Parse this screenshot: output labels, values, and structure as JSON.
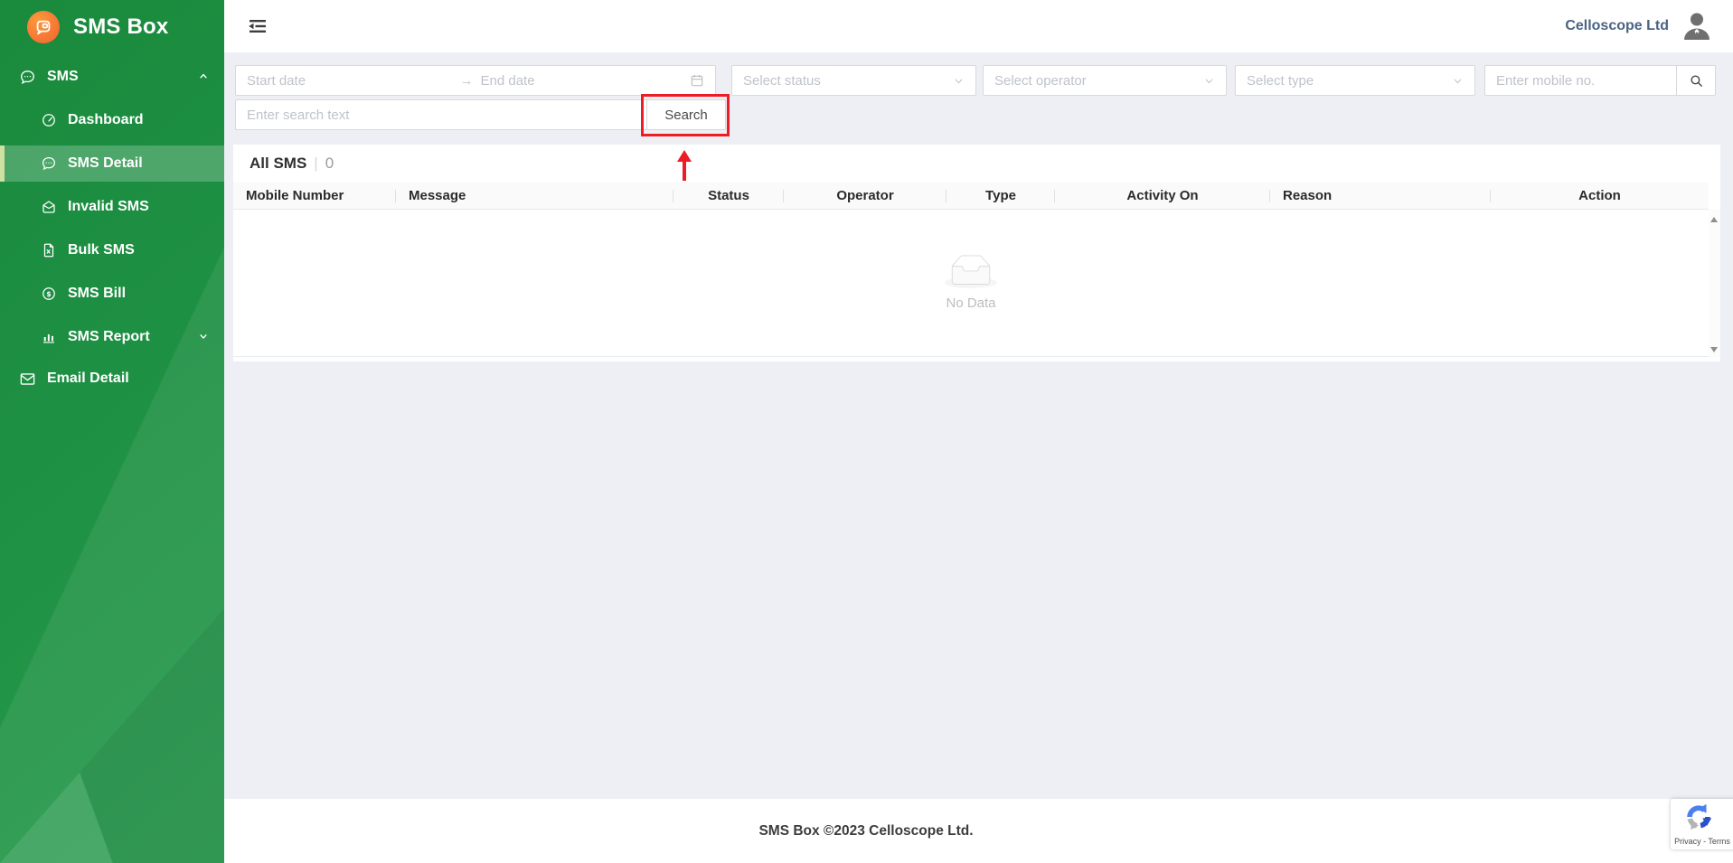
{
  "app": {
    "title": "SMS Box"
  },
  "sidebar": {
    "brand": "SMS Box",
    "menu": {
      "sms": {
        "label": "SMS",
        "expanded": true
      },
      "dashboard": {
        "label": "Dashboard"
      },
      "sms_detail": {
        "label": "SMS Detail",
        "active": true
      },
      "invalid_sms": {
        "label": "Invalid SMS"
      },
      "bulk_sms": {
        "label": "Bulk SMS"
      },
      "sms_bill": {
        "label": "SMS Bill"
      },
      "sms_report": {
        "label": "SMS Report",
        "expanded": false
      },
      "email_detail": {
        "label": "Email Detail"
      }
    }
  },
  "header": {
    "user_name": "Celloscope Ltd"
  },
  "filters": {
    "start_date_placeholder": "Start date",
    "end_date_placeholder": "End date",
    "range_separator": "→",
    "status_placeholder": "Select status",
    "operator_placeholder": "Select operator",
    "type_placeholder": "Select type",
    "mobile_placeholder": "Enter mobile no.",
    "search_text_placeholder": "Enter search text",
    "search_button_label": "Search"
  },
  "table": {
    "title": "All SMS",
    "divider": "|",
    "count": "0",
    "columns": [
      "Mobile Number",
      "Message",
      "Status",
      "Operator",
      "Type",
      "Activity On",
      "Reason",
      "Action"
    ],
    "empty_text": "No Data"
  },
  "footer": {
    "copyright": "SMS Box ©2023 Celloscope Ltd."
  },
  "recaptcha": {
    "label": "Privacy - Terms"
  },
  "colors": {
    "sidebar_green": "#1e9044",
    "active_item_bar": "#cfe0a0",
    "brand_orange": "#f4612f",
    "annotation_red": "#ee1c24",
    "user_name_blue": "#4a6383",
    "content_bg": "#edeff5"
  }
}
